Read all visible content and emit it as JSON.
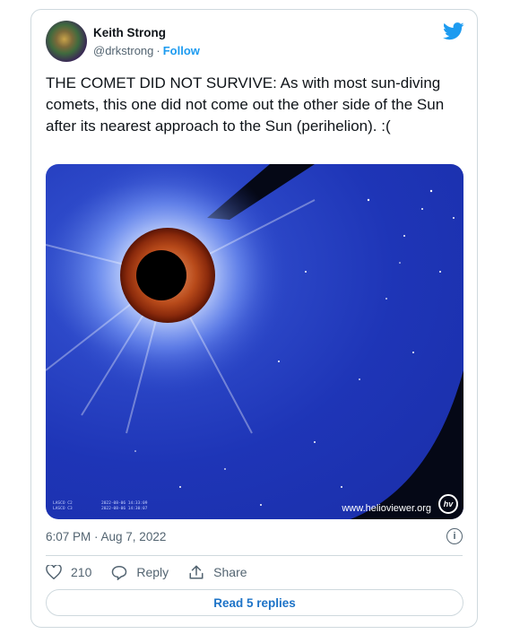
{
  "author": {
    "name": "Keith Strong",
    "handle": "@drkstrong",
    "separator": "·",
    "follow_label": "Follow"
  },
  "tweet": {
    "text": "THE COMET DID NOT SURVIVE: As with most sun-diving comets, this one did not come out the other side of the Sun after its nearest approach to the Sun (perihelion). :(",
    "timestamp": "6:07 PM · Aug 7, 2022"
  },
  "media": {
    "instrument_labels": [
      "LASCO C2",
      "LASCO C3"
    ],
    "dates": [
      "2022-08-06 14:33:09",
      "2022-08-06 14:30:07"
    ],
    "watermark": "www.helioviewer.org",
    "logo_text": "hv"
  },
  "actions": {
    "likes_count": "210",
    "reply_label": "Reply",
    "share_label": "Share"
  },
  "read_replies_label": "Read 5 replies",
  "icons": {
    "brand": "twitter-bird-icon",
    "info": "info-icon",
    "like": "heart-icon",
    "reply": "reply-bubble-icon",
    "share": "share-icon"
  },
  "colors": {
    "accent": "#1d9bf0",
    "text_secondary": "#536471",
    "border": "#cfd9de"
  }
}
